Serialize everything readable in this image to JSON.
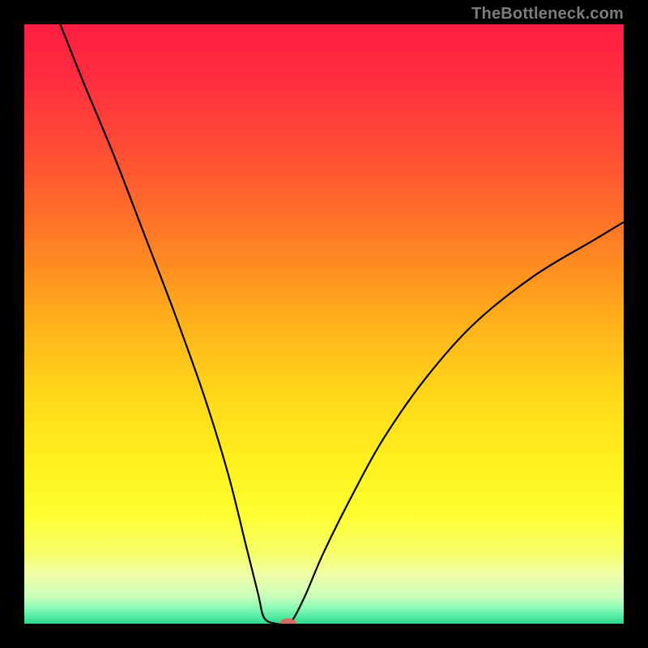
{
  "watermark": "TheBottleneck.com",
  "colors": {
    "gradient_stops": [
      {
        "offset": 0.0,
        "color": "#ff1f41"
      },
      {
        "offset": 0.08,
        "color": "#ff2b40"
      },
      {
        "offset": 0.2,
        "color": "#ff4a35"
      },
      {
        "offset": 0.35,
        "color": "#ff7a26"
      },
      {
        "offset": 0.5,
        "color": "#ffb21a"
      },
      {
        "offset": 0.62,
        "color": "#ffd819"
      },
      {
        "offset": 0.73,
        "color": "#fff01e"
      },
      {
        "offset": 0.82,
        "color": "#feff31"
      },
      {
        "offset": 0.88,
        "color": "#f6ff66"
      },
      {
        "offset": 0.92,
        "color": "#eeffaa"
      },
      {
        "offset": 0.955,
        "color": "#c7ffb8"
      },
      {
        "offset": 0.975,
        "color": "#88f8b5"
      },
      {
        "offset": 0.99,
        "color": "#4de89f"
      },
      {
        "offset": 1.0,
        "color": "#2fd98c"
      }
    ],
    "curve_stroke": "#000000",
    "marker_fill": "#d46a5f"
  },
  "chart_data": {
    "type": "line",
    "title": "",
    "xlabel": "",
    "ylabel": "",
    "xlim": [
      0,
      100
    ],
    "ylim": [
      0,
      100
    ],
    "series": [
      {
        "name": "bottleneck-curve",
        "points": [
          {
            "x": 6,
            "y": 100
          },
          {
            "x": 10,
            "y": 90
          },
          {
            "x": 15,
            "y": 78
          },
          {
            "x": 20,
            "y": 65
          },
          {
            "x": 25,
            "y": 52
          },
          {
            "x": 30,
            "y": 38
          },
          {
            "x": 34,
            "y": 25
          },
          {
            "x": 37,
            "y": 13
          },
          {
            "x": 39,
            "y": 5
          },
          {
            "x": 40,
            "y": 1
          },
          {
            "x": 42,
            "y": 0
          },
          {
            "x": 44,
            "y": 0
          },
          {
            "x": 45,
            "y": 1
          },
          {
            "x": 47,
            "y": 5
          },
          {
            "x": 50,
            "y": 12
          },
          {
            "x": 55,
            "y": 22
          },
          {
            "x": 60,
            "y": 31
          },
          {
            "x": 67,
            "y": 41
          },
          {
            "x": 75,
            "y": 50
          },
          {
            "x": 85,
            "y": 58
          },
          {
            "x": 95,
            "y": 64
          },
          {
            "x": 100,
            "y": 67
          }
        ]
      }
    ],
    "marker": {
      "x": 44,
      "y": 0,
      "rx": 1.4,
      "ry": 0.9
    }
  }
}
